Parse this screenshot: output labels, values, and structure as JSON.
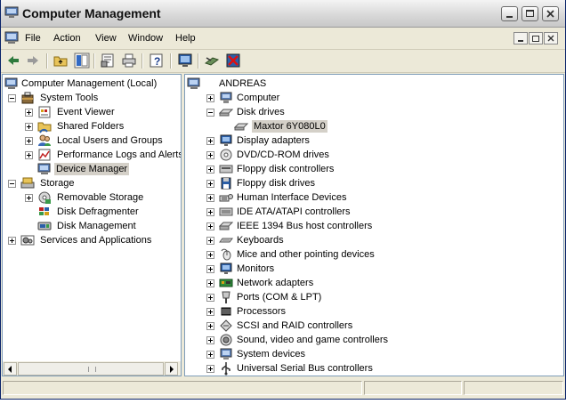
{
  "window": {
    "title": "Computer Management"
  },
  "menu": [
    "File",
    "Action",
    "View",
    "Window",
    "Help"
  ],
  "toolbar": {
    "buttons": [
      "back-arrow-icon",
      "forward-arrow-icon",
      "up-folder-icon",
      "show-hide-tree-icon",
      "properties-icon",
      "print-icon",
      "help-icon",
      "scan-hardware-icon",
      "update-driver-icon",
      "uninstall-icon"
    ]
  },
  "tree": {
    "root": "Computer Management (Local)",
    "system_tools": "System Tools",
    "event_viewer": "Event Viewer",
    "shared_folders": "Shared Folders",
    "local_users": "Local Users and Groups",
    "perf_logs": "Performance Logs and Alerts",
    "device_manager": "Device Manager",
    "storage": "Storage",
    "removable_storage": "Removable Storage",
    "disk_defrag": "Disk Defragmenter",
    "disk_mgmt": "Disk Management",
    "services_apps": "Services and Applications"
  },
  "devices": {
    "computer_name": "ANDREAS",
    "items": [
      "Computer",
      "Disk drives",
      "Maxtor 6Y080L0",
      "Display adapters",
      "DVD/CD-ROM drives",
      "Floppy disk controllers",
      "Floppy disk drives",
      "Human Interface Devices",
      "IDE ATA/ATAPI controllers",
      "IEEE 1394 Bus host controllers",
      "Keyboards",
      "Mice and other pointing devices",
      "Monitors",
      "Network adapters",
      "Ports (COM & LPT)",
      "Processors",
      "SCSI and RAID controllers",
      "Sound, video and game controllers",
      "System devices",
      "Universal Serial Bus controllers"
    ]
  },
  "colors": {
    "selection": "#d4d0c8",
    "accent": "#316ac5",
    "pane_border": "#7f9db9"
  }
}
